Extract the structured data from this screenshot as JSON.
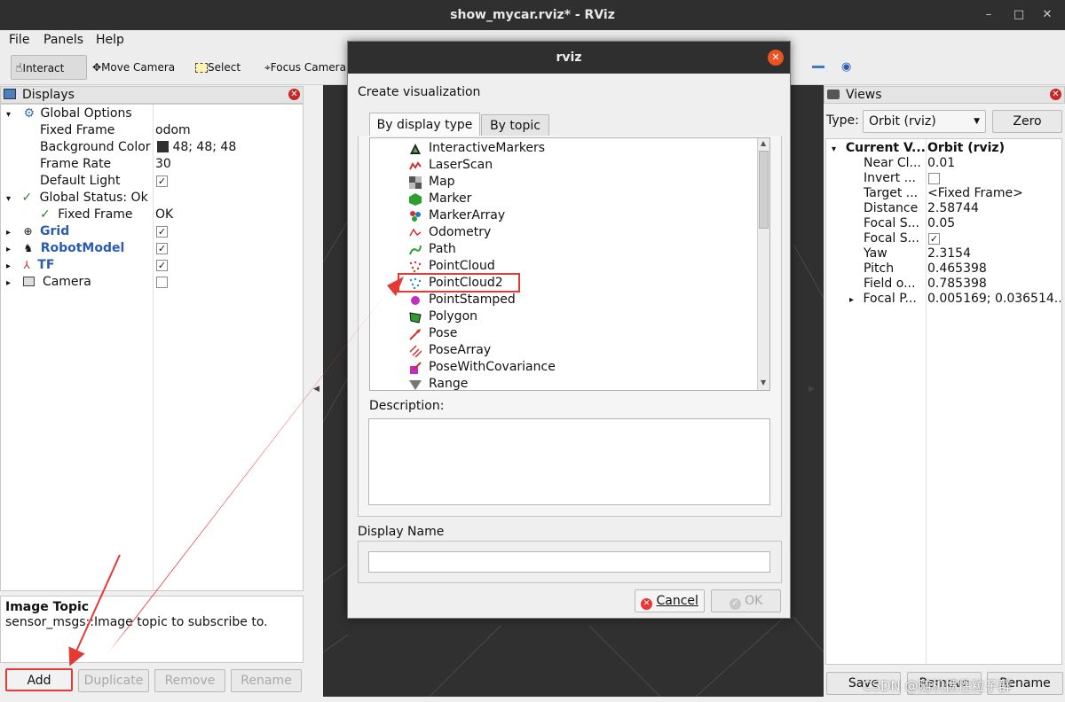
{
  "window": {
    "title": "show_mycar.rviz* - RViz",
    "minimize": "–",
    "maximize": "□",
    "close": "✕"
  },
  "menubar": {
    "file": "File",
    "panels": "Panels",
    "help": "Help"
  },
  "toolbar": {
    "interact": "Interact",
    "move_camera": "Move Camera",
    "select": "Select",
    "focus_camera": "Focus Camera"
  },
  "displays": {
    "title": "Displays",
    "rows": {
      "global_options": "Global Options",
      "fixed_frame_label": "Fixed Frame",
      "fixed_frame_value": "odom",
      "bg_color_label": "Background Color",
      "bg_color_value": "48; 48; 48",
      "frame_rate_label": "Frame Rate",
      "frame_rate_value": "30",
      "default_light_label": "Default Light",
      "global_status": "Global Status: Ok",
      "status_fixed_frame_label": "Fixed Frame",
      "status_fixed_frame_value": "OK",
      "grid": "Grid",
      "robot_model": "RobotModel",
      "tf": "TF",
      "camera": "Camera"
    },
    "info_title": "Image Topic",
    "info_text": "sensor_msgs::Image topic to subscribe to.",
    "buttons": {
      "add": "Add",
      "duplicate": "Duplicate",
      "remove": "Remove",
      "rename": "Rename"
    }
  },
  "views": {
    "title": "Views",
    "type_label": "Type:",
    "type_value": "Orbit (rviz)",
    "zero": "Zero",
    "rows": [
      {
        "label": "Current V...",
        "value": "Orbit (rviz)"
      },
      {
        "label": "Near Cl...",
        "value": "0.01"
      },
      {
        "label": "Invert ...",
        "value": ""
      },
      {
        "label": "Target ...",
        "value": "<Fixed Frame>"
      },
      {
        "label": "Distance",
        "value": "2.58744"
      },
      {
        "label": "Focal S...",
        "value": "0.05"
      },
      {
        "label": "Focal S...",
        "value": ""
      },
      {
        "label": "Yaw",
        "value": "2.3154"
      },
      {
        "label": "Pitch",
        "value": "0.465398"
      },
      {
        "label": "Field o...",
        "value": "0.785398"
      },
      {
        "label": "Focal P...",
        "value": "0.005169; 0.036514..."
      }
    ],
    "buttons": {
      "save": "Save",
      "remove": "Remove",
      "rename": "Rename"
    },
    "watermark": "CSDN @随机惯性粒子群"
  },
  "dialog": {
    "title": "rviz",
    "heading": "Create visualization",
    "tabs": {
      "by_type": "By display type",
      "by_topic": "By topic"
    },
    "items": [
      "InteractiveMarkers",
      "LaserScan",
      "Map",
      "Marker",
      "MarkerArray",
      "Odometry",
      "Path",
      "PointCloud",
      "PointCloud2",
      "PointStamped",
      "Polygon",
      "Pose",
      "PoseArray",
      "PoseWithCovariance",
      "Range"
    ],
    "description_label": "Description:",
    "display_name_label": "Display Name",
    "display_name_value": "",
    "cancel": "Cancel",
    "ok": "OK"
  },
  "colors": {
    "highlight": "#e53935",
    "viewport": "#303030",
    "titlebar": "#2f2f2f"
  }
}
